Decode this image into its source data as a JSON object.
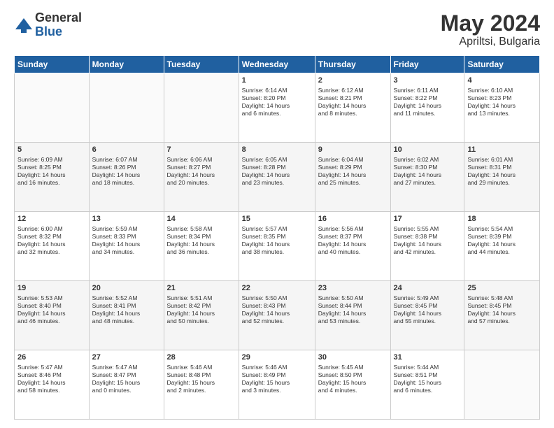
{
  "header": {
    "logo_general": "General",
    "logo_blue": "Blue",
    "month_year": "May 2024",
    "location": "Apriltsi, Bulgaria"
  },
  "weekdays": [
    "Sunday",
    "Monday",
    "Tuesday",
    "Wednesday",
    "Thursday",
    "Friday",
    "Saturday"
  ],
  "weeks": [
    [
      {
        "day": "",
        "info": ""
      },
      {
        "day": "",
        "info": ""
      },
      {
        "day": "",
        "info": ""
      },
      {
        "day": "1",
        "info": "Sunrise: 6:14 AM\nSunset: 8:20 PM\nDaylight: 14 hours\nand 6 minutes."
      },
      {
        "day": "2",
        "info": "Sunrise: 6:12 AM\nSunset: 8:21 PM\nDaylight: 14 hours\nand 8 minutes."
      },
      {
        "day": "3",
        "info": "Sunrise: 6:11 AM\nSunset: 8:22 PM\nDaylight: 14 hours\nand 11 minutes."
      },
      {
        "day": "4",
        "info": "Sunrise: 6:10 AM\nSunset: 8:23 PM\nDaylight: 14 hours\nand 13 minutes."
      }
    ],
    [
      {
        "day": "5",
        "info": "Sunrise: 6:09 AM\nSunset: 8:25 PM\nDaylight: 14 hours\nand 16 minutes."
      },
      {
        "day": "6",
        "info": "Sunrise: 6:07 AM\nSunset: 8:26 PM\nDaylight: 14 hours\nand 18 minutes."
      },
      {
        "day": "7",
        "info": "Sunrise: 6:06 AM\nSunset: 8:27 PM\nDaylight: 14 hours\nand 20 minutes."
      },
      {
        "day": "8",
        "info": "Sunrise: 6:05 AM\nSunset: 8:28 PM\nDaylight: 14 hours\nand 23 minutes."
      },
      {
        "day": "9",
        "info": "Sunrise: 6:04 AM\nSunset: 8:29 PM\nDaylight: 14 hours\nand 25 minutes."
      },
      {
        "day": "10",
        "info": "Sunrise: 6:02 AM\nSunset: 8:30 PM\nDaylight: 14 hours\nand 27 minutes."
      },
      {
        "day": "11",
        "info": "Sunrise: 6:01 AM\nSunset: 8:31 PM\nDaylight: 14 hours\nand 29 minutes."
      }
    ],
    [
      {
        "day": "12",
        "info": "Sunrise: 6:00 AM\nSunset: 8:32 PM\nDaylight: 14 hours\nand 32 minutes."
      },
      {
        "day": "13",
        "info": "Sunrise: 5:59 AM\nSunset: 8:33 PM\nDaylight: 14 hours\nand 34 minutes."
      },
      {
        "day": "14",
        "info": "Sunrise: 5:58 AM\nSunset: 8:34 PM\nDaylight: 14 hours\nand 36 minutes."
      },
      {
        "day": "15",
        "info": "Sunrise: 5:57 AM\nSunset: 8:35 PM\nDaylight: 14 hours\nand 38 minutes."
      },
      {
        "day": "16",
        "info": "Sunrise: 5:56 AM\nSunset: 8:37 PM\nDaylight: 14 hours\nand 40 minutes."
      },
      {
        "day": "17",
        "info": "Sunrise: 5:55 AM\nSunset: 8:38 PM\nDaylight: 14 hours\nand 42 minutes."
      },
      {
        "day": "18",
        "info": "Sunrise: 5:54 AM\nSunset: 8:39 PM\nDaylight: 14 hours\nand 44 minutes."
      }
    ],
    [
      {
        "day": "19",
        "info": "Sunrise: 5:53 AM\nSunset: 8:40 PM\nDaylight: 14 hours\nand 46 minutes."
      },
      {
        "day": "20",
        "info": "Sunrise: 5:52 AM\nSunset: 8:41 PM\nDaylight: 14 hours\nand 48 minutes."
      },
      {
        "day": "21",
        "info": "Sunrise: 5:51 AM\nSunset: 8:42 PM\nDaylight: 14 hours\nand 50 minutes."
      },
      {
        "day": "22",
        "info": "Sunrise: 5:50 AM\nSunset: 8:43 PM\nDaylight: 14 hours\nand 52 minutes."
      },
      {
        "day": "23",
        "info": "Sunrise: 5:50 AM\nSunset: 8:44 PM\nDaylight: 14 hours\nand 53 minutes."
      },
      {
        "day": "24",
        "info": "Sunrise: 5:49 AM\nSunset: 8:45 PM\nDaylight: 14 hours\nand 55 minutes."
      },
      {
        "day": "25",
        "info": "Sunrise: 5:48 AM\nSunset: 8:45 PM\nDaylight: 14 hours\nand 57 minutes."
      }
    ],
    [
      {
        "day": "26",
        "info": "Sunrise: 5:47 AM\nSunset: 8:46 PM\nDaylight: 14 hours\nand 58 minutes."
      },
      {
        "day": "27",
        "info": "Sunrise: 5:47 AM\nSunset: 8:47 PM\nDaylight: 15 hours\nand 0 minutes."
      },
      {
        "day": "28",
        "info": "Sunrise: 5:46 AM\nSunset: 8:48 PM\nDaylight: 15 hours\nand 2 minutes."
      },
      {
        "day": "29",
        "info": "Sunrise: 5:46 AM\nSunset: 8:49 PM\nDaylight: 15 hours\nand 3 minutes."
      },
      {
        "day": "30",
        "info": "Sunrise: 5:45 AM\nSunset: 8:50 PM\nDaylight: 15 hours\nand 4 minutes."
      },
      {
        "day": "31",
        "info": "Sunrise: 5:44 AM\nSunset: 8:51 PM\nDaylight: 15 hours\nand 6 minutes."
      },
      {
        "day": "",
        "info": ""
      }
    ]
  ]
}
